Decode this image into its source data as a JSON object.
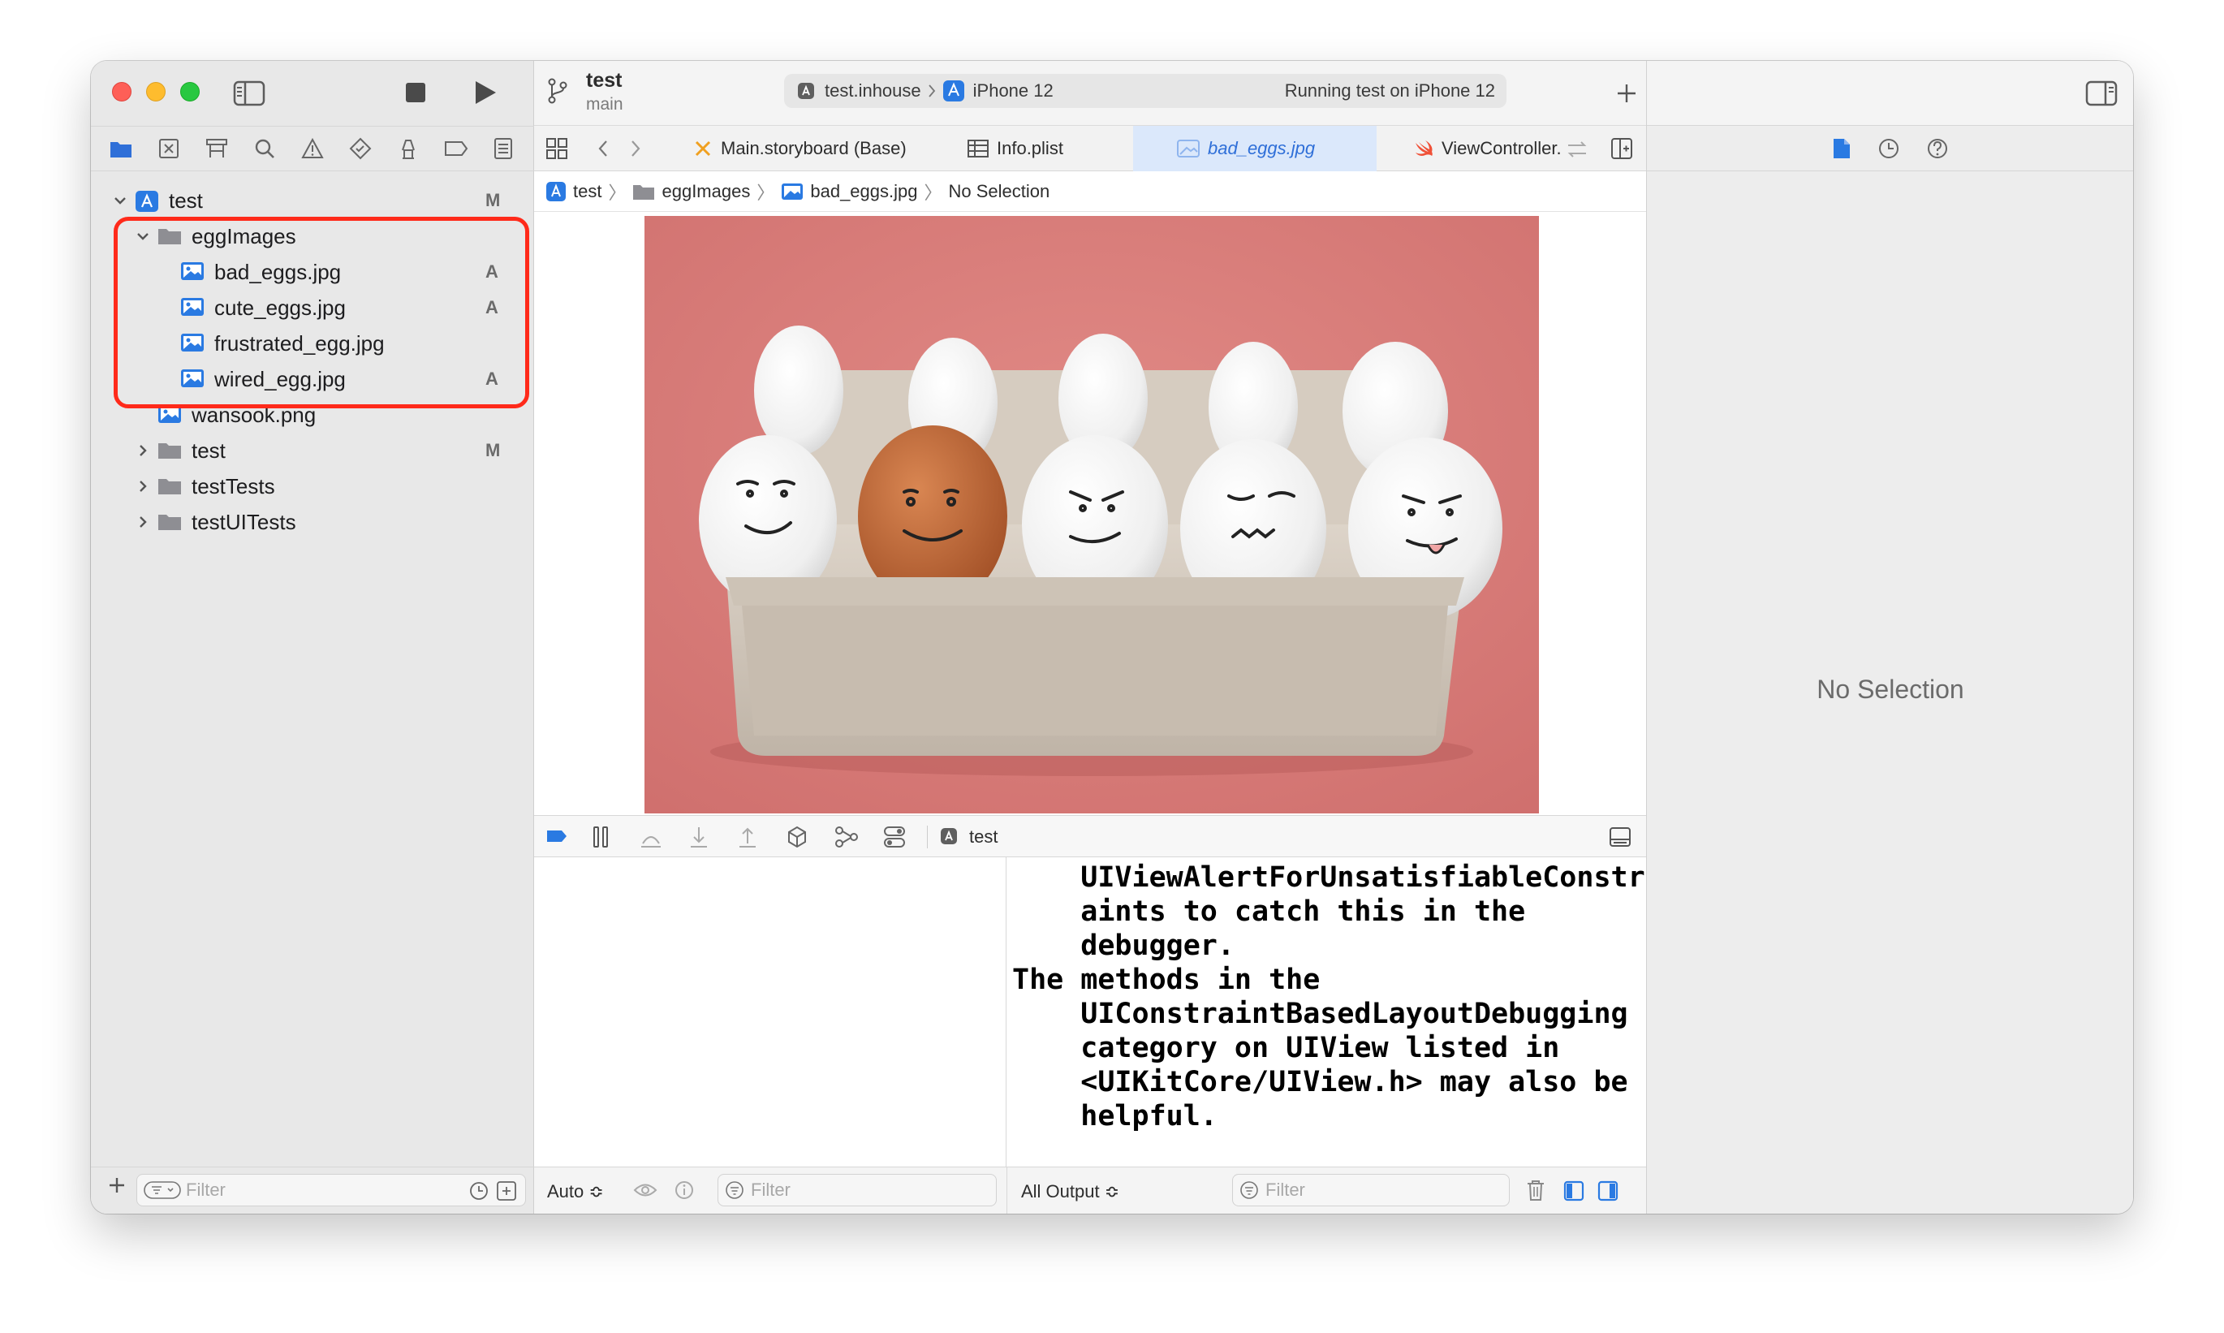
{
  "toolbar": {
    "scheme_title": "test",
    "scheme_branch": "main",
    "destination_scheme": "test.inhouse",
    "destination_device": "iPhone 12",
    "status": "Running test on iPhone 12"
  },
  "navigator": {
    "items": [
      {
        "label": "test",
        "status": "M"
      },
      {
        "label": "eggImages",
        "status": ""
      },
      {
        "label": "bad_eggs.jpg",
        "status": "A"
      },
      {
        "label": "cute_eggs.jpg",
        "status": "A"
      },
      {
        "label": "frustrated_egg.jpg",
        "status": ""
      },
      {
        "label": "wired_egg.jpg",
        "status": "A"
      },
      {
        "label": "wansook.png",
        "status": ""
      },
      {
        "label": "test",
        "status": "M"
      },
      {
        "label": "testTests",
        "status": ""
      },
      {
        "label": "testUITests",
        "status": ""
      }
    ],
    "filter_placeholder": "Filter"
  },
  "tabs": [
    {
      "label": "Main.storyboard (Base)"
    },
    {
      "label": "Info.plist"
    },
    {
      "label": "bad_eggs.jpg"
    },
    {
      "label": "ViewController.s"
    }
  ],
  "jumpbar": {
    "items": [
      "test",
      "eggImages",
      "bad_eggs.jpg",
      "No Selection"
    ]
  },
  "debug": {
    "process_label": "test",
    "console_text": "    UIViewAlertForUnsatisfiableConstr\n    aints to catch this in the\n    debugger.\nThe methods in the\n    UIConstraintBasedLayoutDebugging\n    category on UIView listed in\n    <UIKitCore/UIView.h> may also be\n    helpful.",
    "vars_mode": "Auto ≎",
    "vars_filter_placeholder": "Filter",
    "output_mode": "All Output ≎",
    "console_filter_placeholder": "Filter"
  },
  "inspector": {
    "empty_text": "No Selection"
  },
  "colors": {
    "accent": "#2f6fd8",
    "highlight_box": "#ff2a1a",
    "photo_background": "#d97d7b"
  }
}
